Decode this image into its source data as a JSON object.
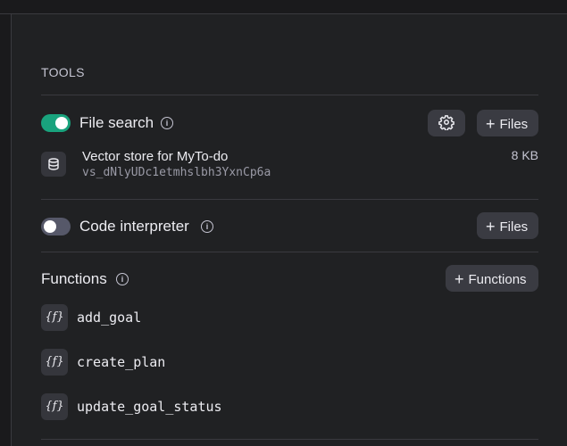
{
  "tools": {
    "section_title": "TOOLS",
    "file_search": {
      "label": "File search",
      "enabled": true,
      "files_button": "Files",
      "vector_store": {
        "name": "Vector store for MyTo-do",
        "id": "vs_dNlyUDc1etmhslbh3YxnCp6a",
        "size": "8 KB"
      }
    },
    "code_interpreter": {
      "label": "Code interpreter",
      "enabled": false,
      "files_button": "Files"
    },
    "functions": {
      "title": "Functions",
      "add_button": "Functions",
      "icon_text": "{f}",
      "items": [
        {
          "name": "add_goal"
        },
        {
          "name": "create_plan"
        },
        {
          "name": "update_goal_status"
        }
      ]
    }
  },
  "colors": {
    "background": "#202123",
    "toggle_on": "#19a37d",
    "toggle_off": "#565869",
    "button_bg": "#3a3b42"
  }
}
